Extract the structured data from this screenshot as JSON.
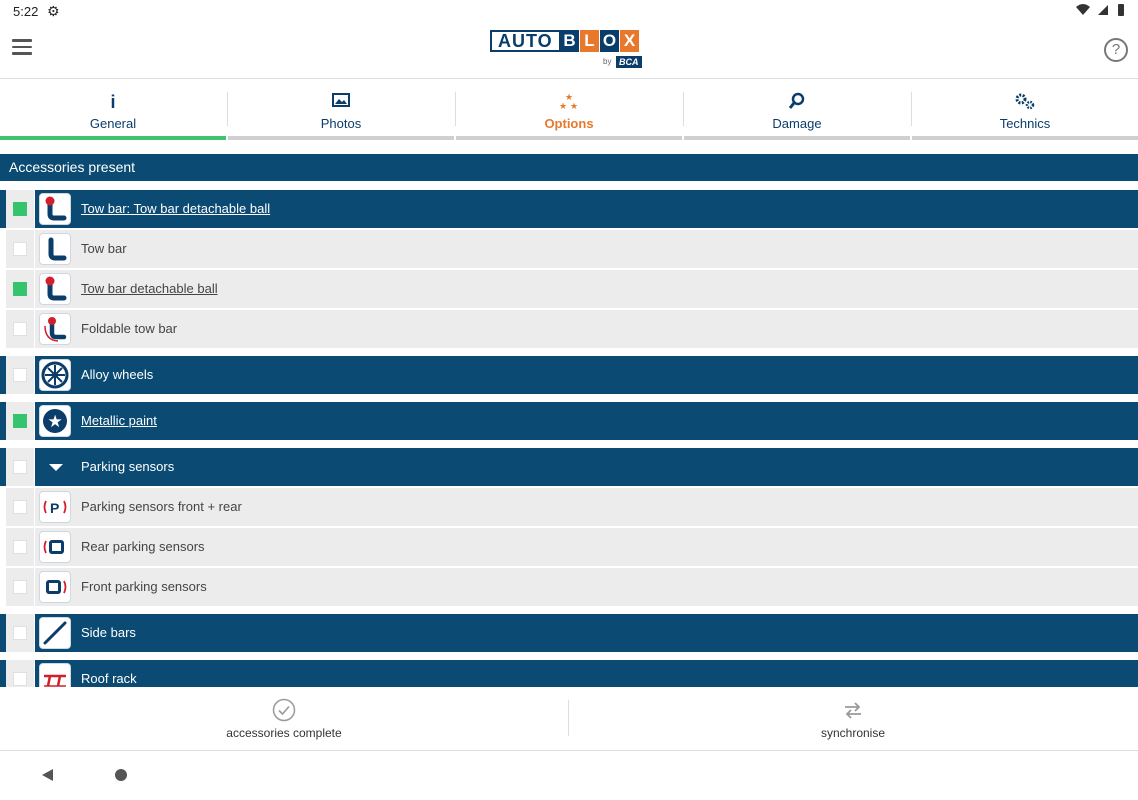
{
  "status": {
    "time": "5:22",
    "gear_icon": "settings-gear-icon",
    "right_icons": "wifi, signal, battery"
  },
  "appbar": {
    "logo": {
      "auto": "AUTO",
      "blox": [
        "B",
        "L",
        "O",
        "X"
      ],
      "blox_colors": [
        "#0b3d6b",
        "#e8782b",
        "#0b3d6b",
        "#e8782b"
      ],
      "by": "by",
      "bca": "BCA"
    },
    "help": "?"
  },
  "tabs": [
    {
      "label": "General",
      "icon": "i"
    },
    {
      "label": "Photos",
      "icon": "🖼"
    },
    {
      "label": "Options",
      "icon": "⁂"
    },
    {
      "label": "Damage",
      "icon": "⚲"
    },
    {
      "label": "Technics",
      "icon": "⚙"
    }
  ],
  "colors": {
    "navy": "#0b4a72",
    "accent": "#e8782b",
    "checked": "#35c46d",
    "active_tab": "#3cc46f"
  },
  "section": {
    "title": "Accessories present"
  },
  "rows": [
    {
      "type": "main",
      "label": "Tow bar: Tow bar detachable ball",
      "checked": true,
      "underline": true,
      "icon": "tow-bar-ball-icon"
    },
    {
      "type": "sub",
      "label": "Tow bar",
      "checked": false,
      "underline": false,
      "icon": "tow-bar-icon"
    },
    {
      "type": "sub",
      "label": "Tow bar detachable ball",
      "checked": true,
      "underline": true,
      "icon": "tow-bar-ball-icon"
    },
    {
      "type": "sub",
      "label": "Foldable tow bar",
      "checked": false,
      "underline": false,
      "icon": "foldable-tow-bar-icon"
    },
    {
      "type": "main",
      "label": "Alloy wheels",
      "checked": false,
      "underline": false,
      "icon": "alloy-wheel-icon"
    },
    {
      "type": "main",
      "label": "Metallic paint",
      "checked": true,
      "underline": true,
      "icon": "metallic-paint-icon"
    },
    {
      "type": "main",
      "label": "Parking sensors",
      "checked": false,
      "underline": false,
      "icon": "expand-triangle-icon"
    },
    {
      "type": "sub",
      "label": "Parking sensors front + rear",
      "checked": false,
      "underline": false,
      "icon": "parking-sensors-icon"
    },
    {
      "type": "sub",
      "label": "Rear parking sensors",
      "checked": false,
      "underline": false,
      "icon": "rear-parking-sensors-icon"
    },
    {
      "type": "sub",
      "label": "Front parking sensors",
      "checked": false,
      "underline": false,
      "icon": "front-parking-sensors-icon"
    },
    {
      "type": "main",
      "label": "Side bars",
      "checked": false,
      "underline": false,
      "icon": "side-bars-icon"
    },
    {
      "type": "main",
      "label": "Roof rack",
      "checked": false,
      "underline": false,
      "icon": "roof-rack-icon"
    }
  ],
  "footer": {
    "left_label": "accessories complete",
    "right_label": "synchronise"
  }
}
